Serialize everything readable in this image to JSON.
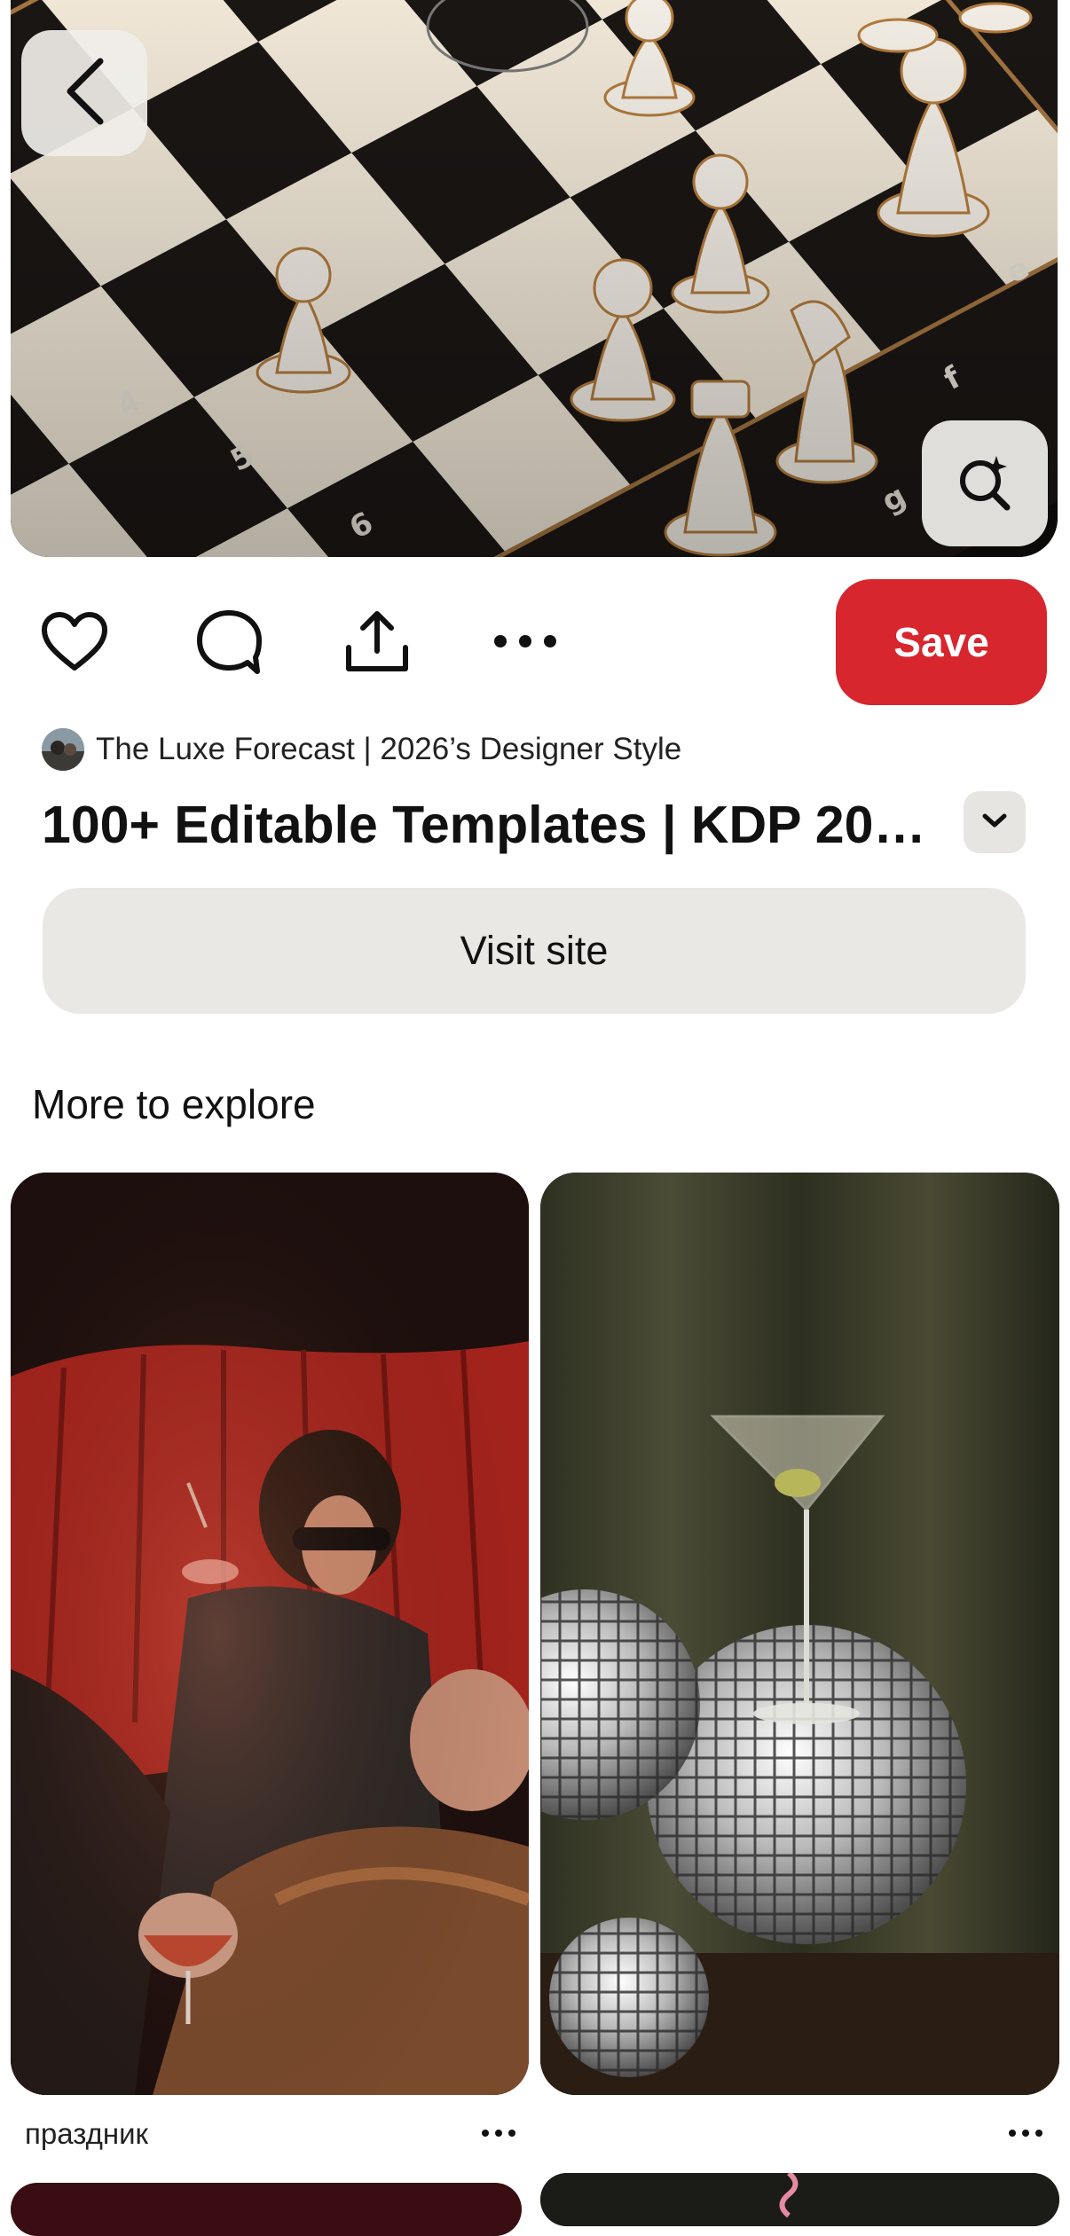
{
  "pin": {
    "image_description_icon": "chess-board-photo",
    "creator_name": "The Luxe Forecast | 2026’s Designer Style",
    "title": "100+ Editable Templates | KDP 202...",
    "save_label": "Save",
    "visit_label": "Visit site"
  },
  "actions": {
    "like_icon": "heart-icon",
    "comment_icon": "comment-icon",
    "share_icon": "share-icon",
    "more_icon": "more-icon"
  },
  "explore": {
    "heading": "More to explore",
    "cards": [
      {
        "caption": "праздник"
      },
      {
        "caption": ""
      }
    ]
  },
  "colors": {
    "save_red": "#d7262e",
    "secondary_button": "#e9e8e4"
  }
}
